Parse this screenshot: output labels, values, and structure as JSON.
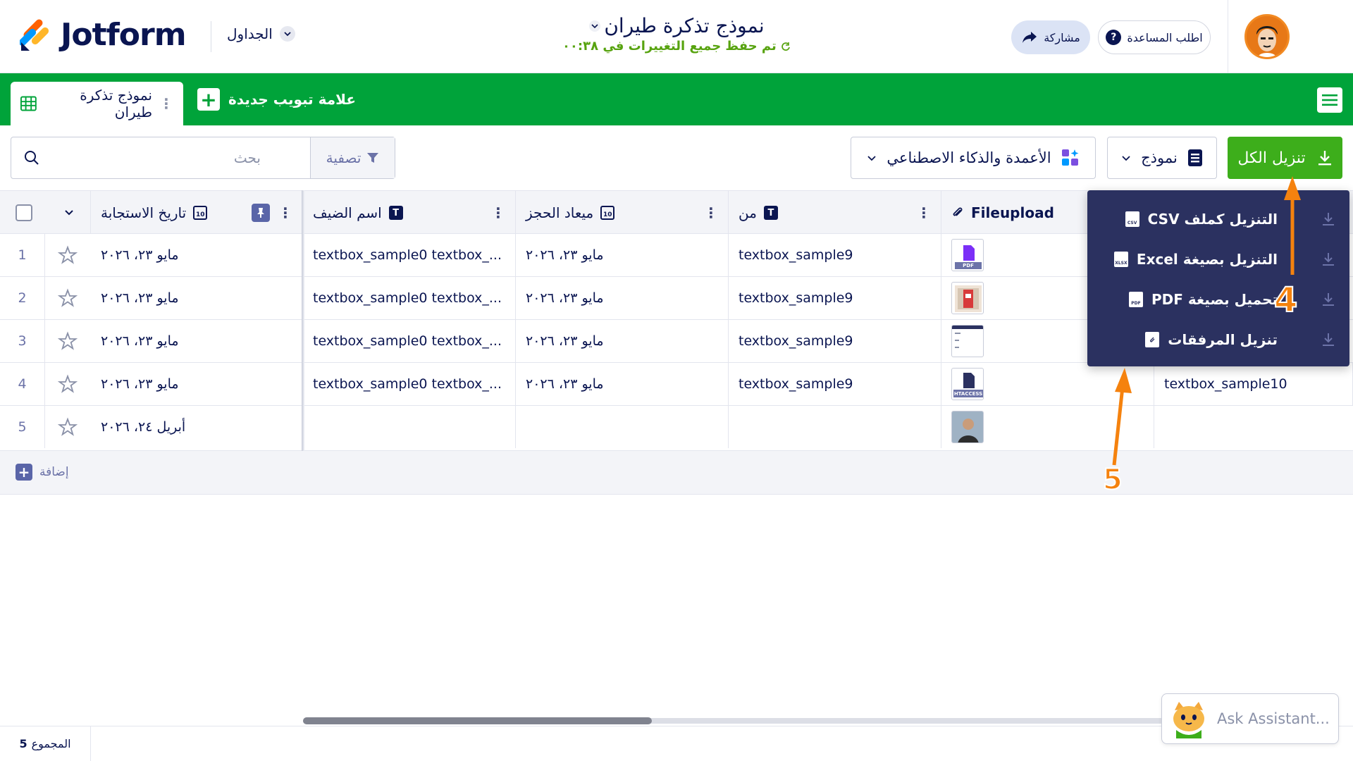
{
  "header": {
    "brand": "Jotform",
    "tables_menu": "الجداول",
    "title": "نموذج تذكرة طيران",
    "save_status": "تم حفظ جميع التغييرات في ٠٠:٣٨",
    "help_label": "اطلب المساعدة",
    "share_label": "مشاركة"
  },
  "tabs": {
    "active_label": "نموذج تذكرة طيران",
    "new_tab_label": "علامة تبويب جديدة"
  },
  "toolbar": {
    "search_placeholder": "بحث",
    "filter_label": "تصفية",
    "ai_label": "الأعمدة والذكاء الاصطناعي",
    "form_label": "نموذج",
    "download_all_label": "تنزيل الكل"
  },
  "columns": {
    "response_date": "تاريخ الاستجابة",
    "guest_name": "اسم الضيف",
    "booking_date": "ميعاد الحجز",
    "from": "من",
    "fileupload": "Fileupload"
  },
  "rows": [
    {
      "num": "1",
      "date": "مايو ٢٣، ٢٠٢٦",
      "guest": "textbox_sample0 textbox_...",
      "booking": "مايو ٢٣، ٢٠٢٦",
      "from": "textbox_sample9",
      "file": "pdf",
      "extra": ""
    },
    {
      "num": "2",
      "date": "مايو ٢٣، ٢٠٢٦",
      "guest": "textbox_sample0 textbox_...",
      "booking": "مايو ٢٣، ٢٠٢٦",
      "from": "textbox_sample9",
      "file": "image-red",
      "extra": ""
    },
    {
      "num": "3",
      "date": "مايو ٢٣، ٢٠٢٦",
      "guest": "textbox_sample0 textbox_...",
      "booking": "مايو ٢٣، ٢٠٢٦",
      "from": "textbox_sample9",
      "file": "doc",
      "extra": ""
    },
    {
      "num": "4",
      "date": "مايو ٢٣، ٢٠٢٦",
      "guest": "textbox_sample0 textbox_...",
      "booking": "مايو ٢٣، ٢٠٢٦",
      "from": "textbox_sample9",
      "file": "htaccess",
      "extra": "textbox_sample10"
    },
    {
      "num": "5",
      "date": "أبريل ٢٤، ٢٠٢٦",
      "guest": "",
      "booking": "",
      "from": "",
      "file": "photo",
      "extra": ""
    }
  ],
  "file_badges": {
    "pdf": "PDF",
    "htaccess": "HTACCESS"
  },
  "add_row_label": "إضافة",
  "dropdown": {
    "items": [
      {
        "label": "التنزيل كملف CSV",
        "badge": "CSV"
      },
      {
        "label": "التنزيل بصيغة Excel",
        "badge": "XLSX"
      },
      {
        "label": "تحميل بصيغة PDF",
        "badge": "PDF"
      },
      {
        "label": "تنزيل المرفقات",
        "badge": ""
      }
    ]
  },
  "annotations": {
    "step_4": "4",
    "step_5": "5"
  },
  "footer": {
    "total_label": "المجموع",
    "total_count": "5"
  },
  "assistant": {
    "placeholder": "Ask Assistant..."
  },
  "colors": {
    "brand_green": "#00a33a",
    "download_green": "#3dae1b",
    "navy": "#0a1551",
    "dropdown_bg": "#2b3160",
    "annotation_orange": "#f5820e"
  }
}
